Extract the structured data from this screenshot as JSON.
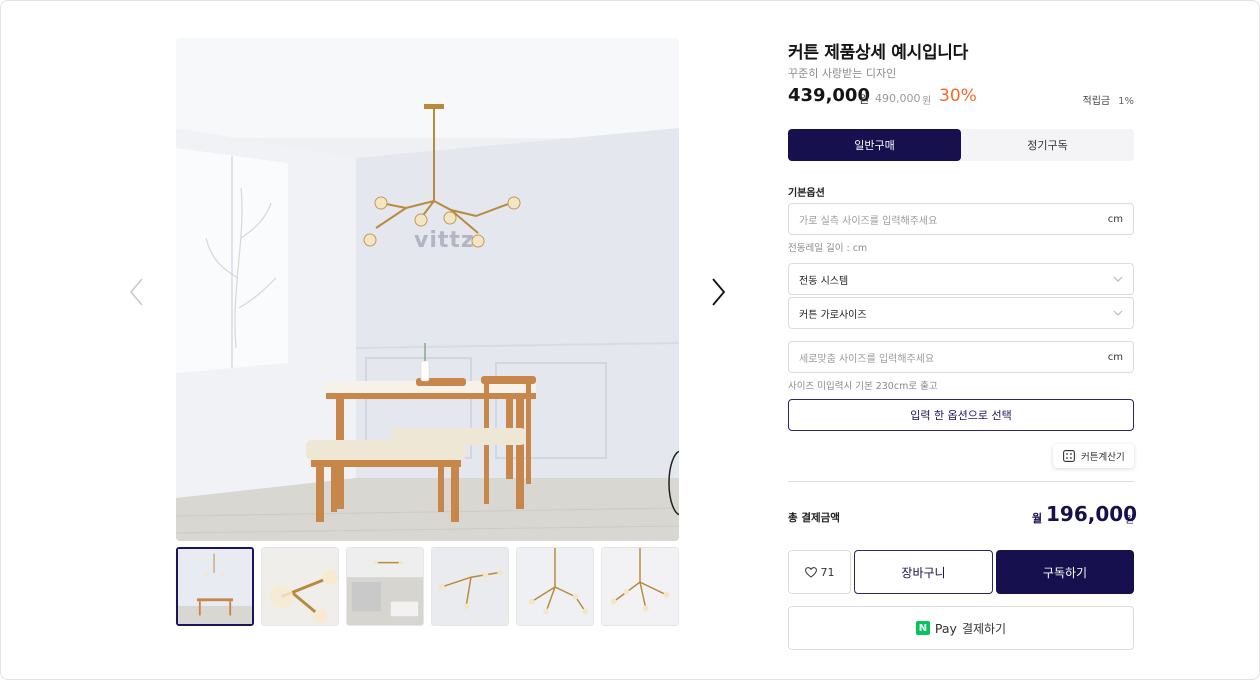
{
  "product": {
    "title": "커튼 제품상세 예시입니다",
    "subtitle": "꾸준히 사랑받는 디자인",
    "price": "439,000",
    "price_unit": "원",
    "original_price": "490,000",
    "original_unit": "원",
    "discount": "30%",
    "points_label": "적립금",
    "points_value": "1%",
    "watermark": "vittz"
  },
  "purchase_tabs": [
    {
      "label": "일반구매",
      "active": true
    },
    {
      "label": "정기구독",
      "active": false
    }
  ],
  "options": {
    "section_label": "기본옵션",
    "width_placeholder": "가로 실측 사이즈를 입력해주세요",
    "width_unit": "cm",
    "width_helper": "전동레일 길이 : cm",
    "system_select": "전동 시스템",
    "curtain_select": "커튼 가로사이즈",
    "height_placeholder": "세로맞춤 사이즈를 입력해주세요",
    "height_unit": "cm",
    "height_helper": "사이즈 미입력시 기본 230cm로 출고",
    "select_button": "입력 한 옵션으로 선택",
    "calculator_button": "커튼계산기"
  },
  "total": {
    "label": "총 결제금액",
    "prefix": "월",
    "amount": "196,000",
    "unit": "원"
  },
  "actions": {
    "like_count": "71",
    "cart": "장바구니",
    "subscribe": "구독하기",
    "npay_logo": "N",
    "npay_pay": "Pay",
    "npay_label": "결제하기"
  },
  "colors": {
    "brand": "#16104e",
    "discount": "#f26b2a",
    "npay": "#03c75a"
  },
  "gallery": {
    "thumbnail_count": 6,
    "active_thumbnail": 1
  }
}
